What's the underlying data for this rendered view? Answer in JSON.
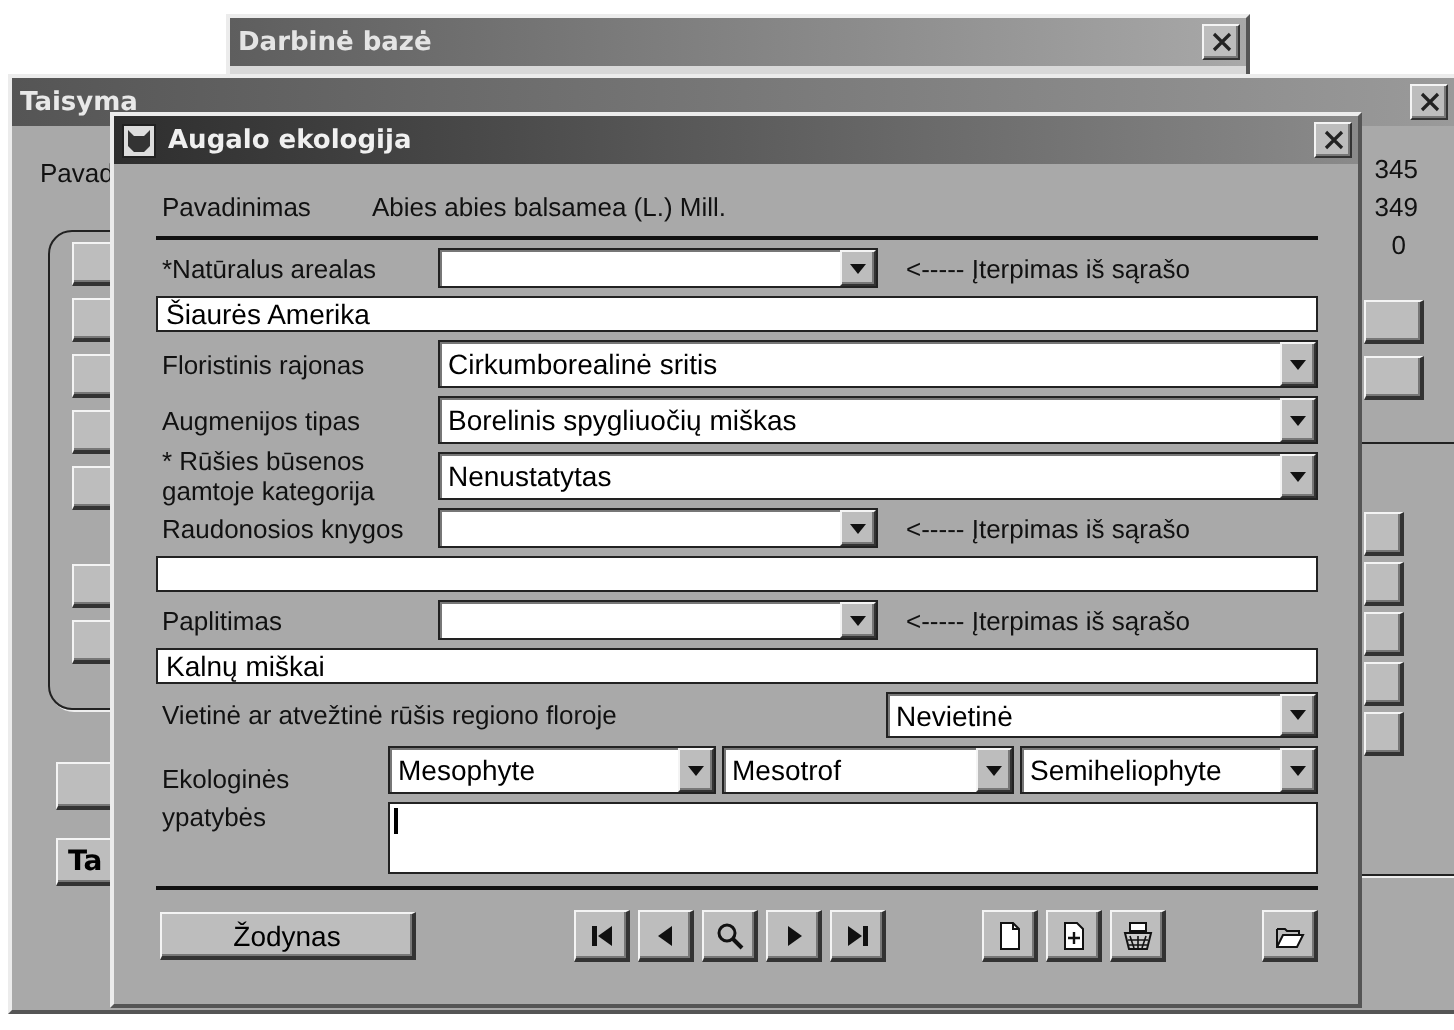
{
  "workbase_window": {
    "title": "Darbinė bazė"
  },
  "edit_window": {
    "title": "Taisyma",
    "label": "Pavad",
    "counts": [
      "345",
      "349",
      "0"
    ],
    "button": "Ta"
  },
  "dialog": {
    "title": "Augalo ekologija",
    "name_label": "Pavadinimas",
    "name_value": "Abies abies balsamea (L.) Mill.",
    "rows": [
      {
        "kind": "pick",
        "label": "*Natūralus arealas",
        "hint": "<----- Įterpimas iš sąrašo"
      },
      {
        "kind": "text",
        "value": "Šiaurės Amerika"
      },
      {
        "kind": "select",
        "label": "Floristinis rajonas",
        "value": "Cirkumborealinė sritis"
      },
      {
        "kind": "select",
        "label": "Augmenijos tipas",
        "value": "Borelinis spygliuočių miškas"
      },
      {
        "kind": "select",
        "label": "* Rūšies būsenos gamtoje kategorija",
        "value": "Nenustatytas"
      },
      {
        "kind": "pick",
        "label": "Raudonosios knygos",
        "hint": "<----- Įterpimas iš sąrašo"
      },
      {
        "kind": "text"
      },
      {
        "kind": "pick",
        "label": "Paplitimas",
        "hint": "<----- Įterpimas iš sąrašo"
      },
      {
        "kind": "text",
        "value": "Kalnų miškai"
      },
      {
        "kind": "side-select",
        "label": "Vietinė ar atvežtinė rūšis regiono floroje",
        "value": "Nevietinė"
      }
    ],
    "ecology": {
      "label": "Ekologinės ypatybės",
      "options": [
        "Mesophyte",
        "Mesotrof",
        "Semiheliophyte"
      ]
    },
    "dictionary_button": "Žodynas"
  }
}
